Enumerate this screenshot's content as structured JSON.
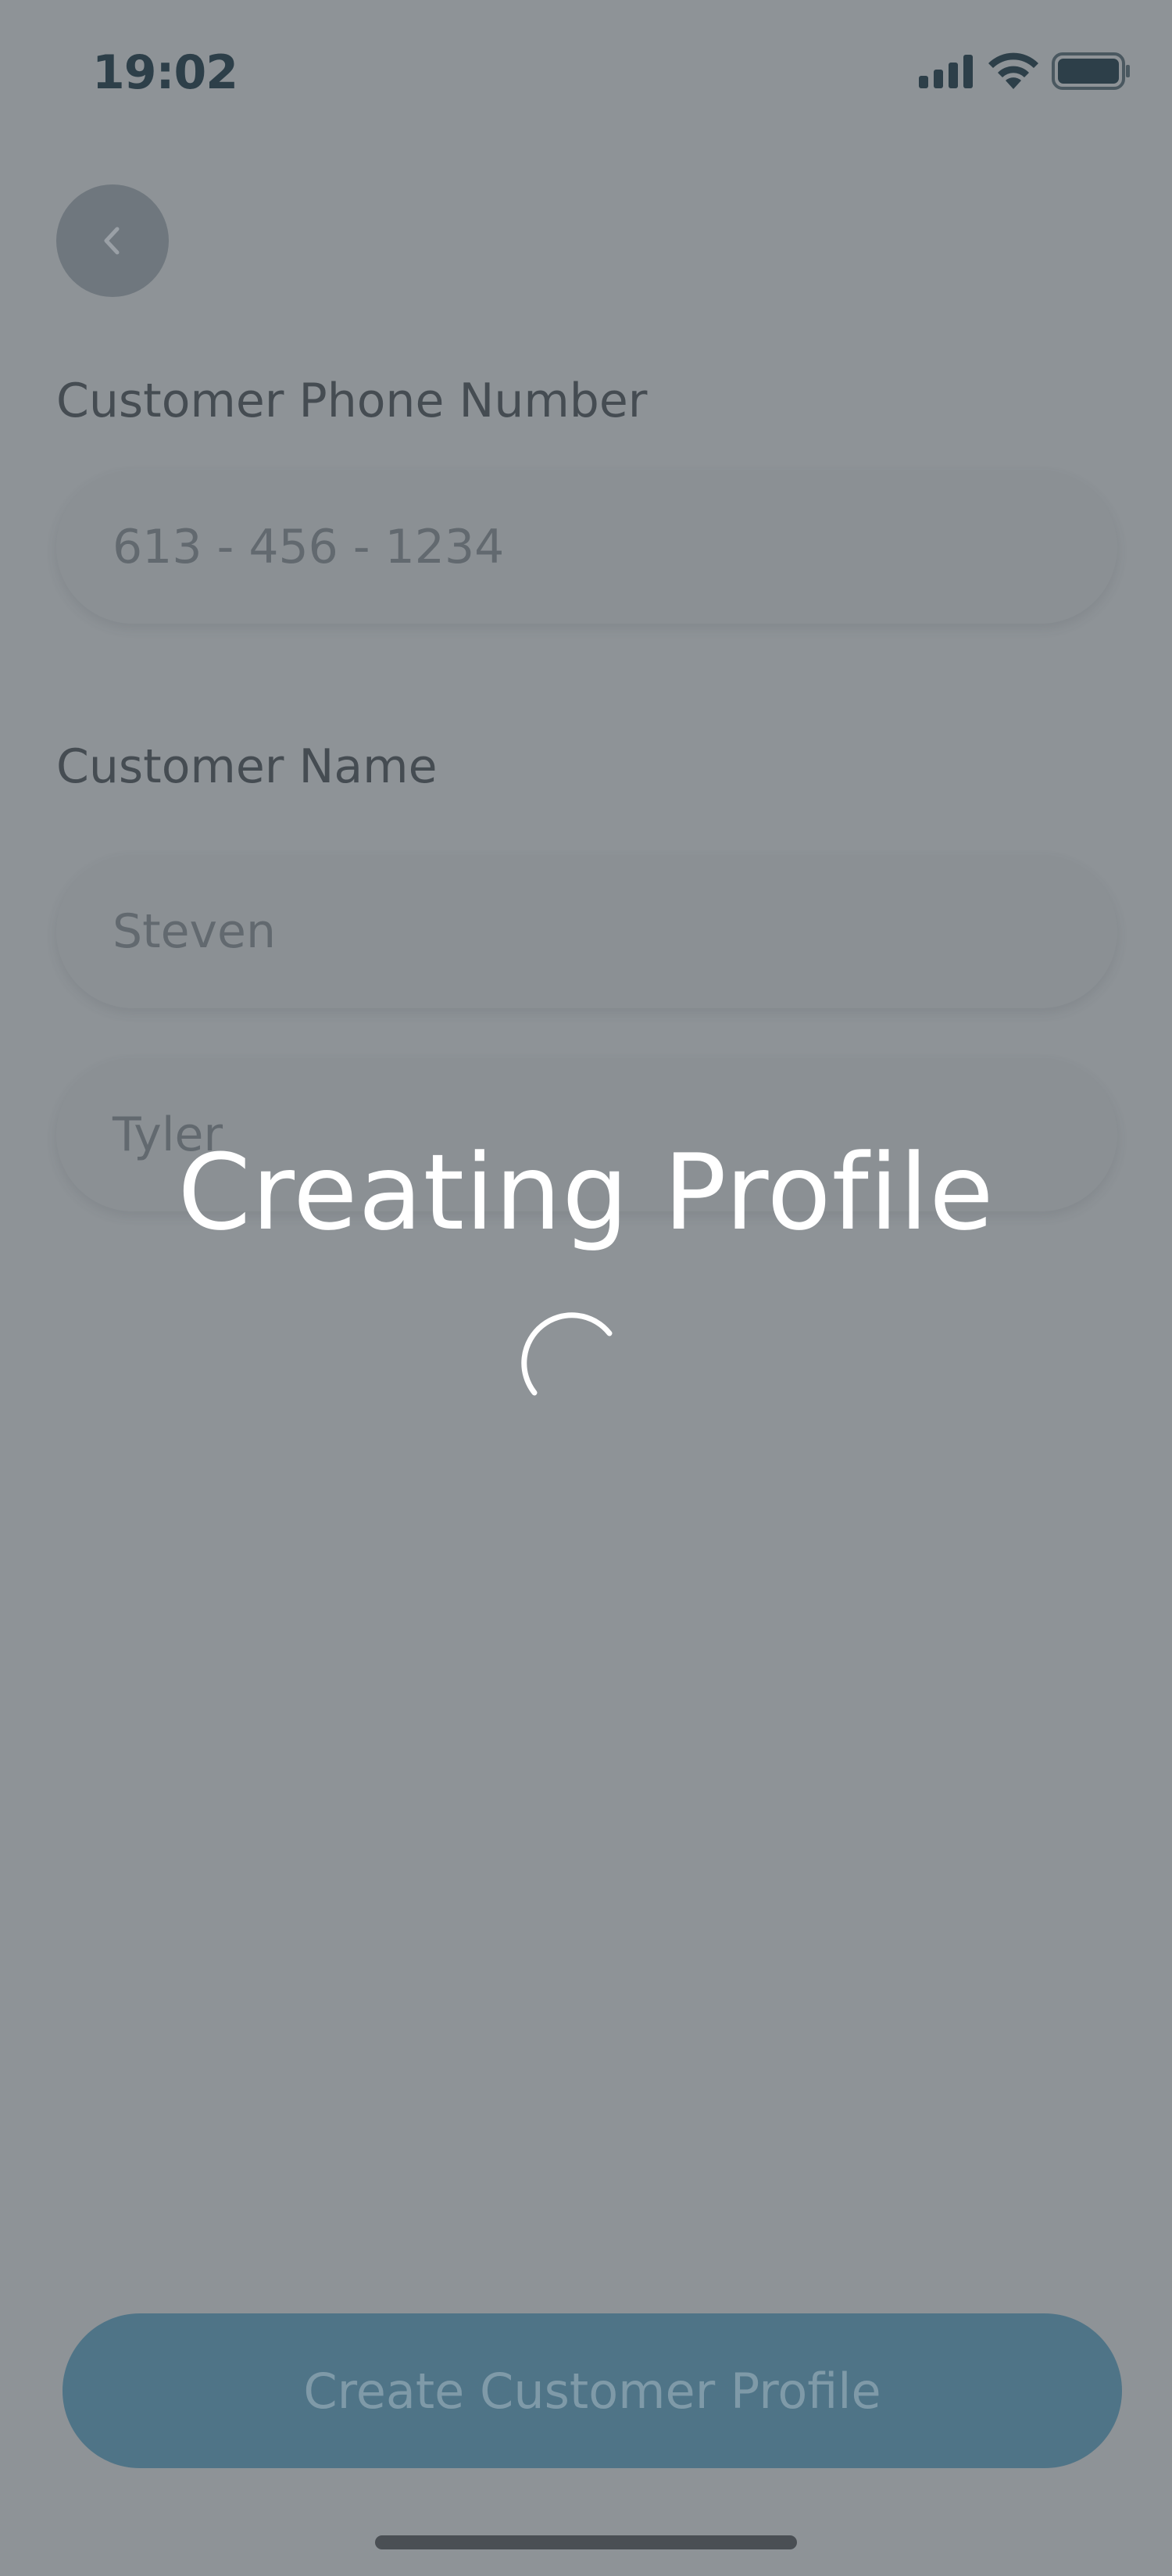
{
  "status_bar": {
    "time": "19:02"
  },
  "icons": {
    "back": "chevron-left-icon",
    "signal": "cellular-signal-icon",
    "wifi": "wifi-icon",
    "battery": "battery-icon",
    "spinner": "loading-spinner-icon"
  },
  "form": {
    "phone_label": "Customer Phone Number",
    "phone_placeholder": "613 - 456 - 1234",
    "name_label": "Customer Name",
    "first_name_placeholder": "Steven",
    "last_name_placeholder": "Tyler"
  },
  "overlay": {
    "title": "Creating Profile"
  },
  "actions": {
    "create_label": "Create Customer Profile"
  },
  "colors": {
    "scrim": "#8e9397",
    "status_text": "#2d3f49",
    "primary_button": "#4f7487",
    "primary_button_text": "#7f9aa8",
    "overlay_text": "#ffffff"
  }
}
